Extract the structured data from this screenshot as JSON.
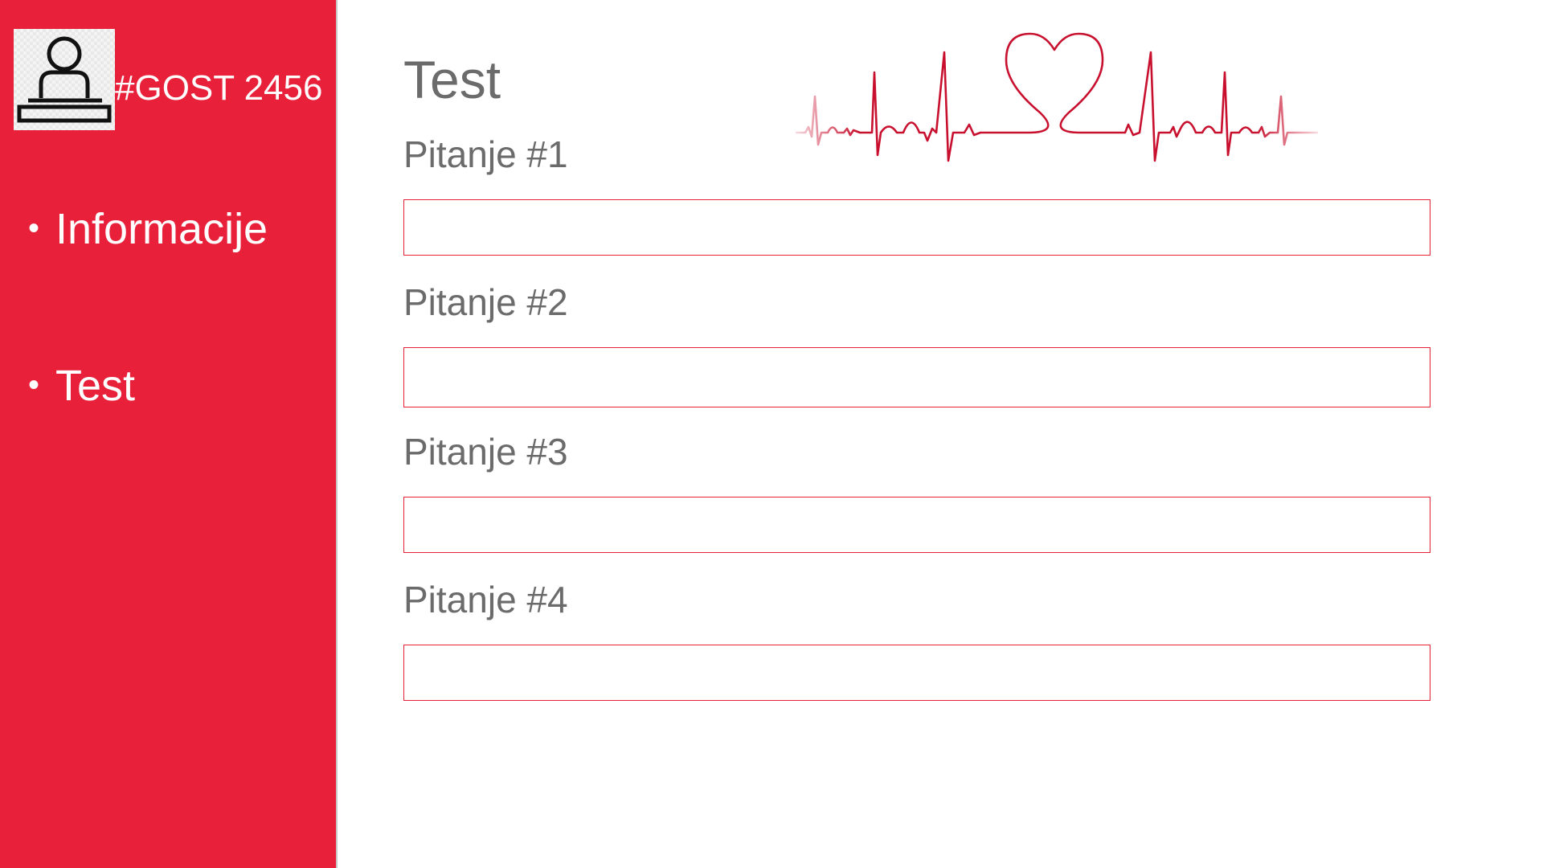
{
  "sidebar": {
    "user_id": "#GOST 2456",
    "avatar_icon": "user-at-desk-icon",
    "bullet": "•",
    "items": [
      {
        "label": "Informacije"
      },
      {
        "label": "Test"
      }
    ]
  },
  "main": {
    "title": "Test",
    "decoration_icon": "heartbeat-heart-icon",
    "questions": [
      {
        "label": "Pitanje #1",
        "value": ""
      },
      {
        "label": "Pitanje #2",
        "value": ""
      },
      {
        "label": "Pitanje #3",
        "value": ""
      },
      {
        "label": "Pitanje #4",
        "value": ""
      }
    ]
  },
  "colors": {
    "accent": "#E8203A",
    "text_gray": "#6b6b6b",
    "ekg_line": "#C8102E"
  }
}
